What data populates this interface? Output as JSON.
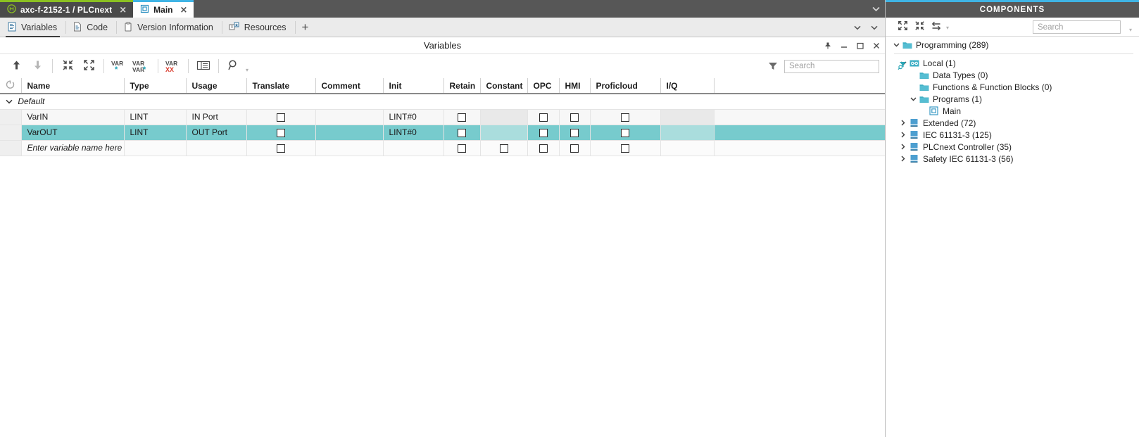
{
  "window": {
    "tabs": [
      {
        "label": "axc-f-2152-1 / PLCnext",
        "icon": "plc-device-icon",
        "close": "×",
        "active": false
      },
      {
        "label": "Main",
        "icon": "program-icon",
        "close": "×",
        "active": true
      }
    ],
    "overflow_chevron": "⌄"
  },
  "subtabs": {
    "items": [
      {
        "label": "Variables",
        "icon": "variables-icon",
        "active": true
      },
      {
        "label": "Code",
        "icon": "code-icon",
        "active": false
      },
      {
        "label": "Version Information",
        "icon": "version-information-icon",
        "active": false
      },
      {
        "label": "Resources",
        "icon": "resources-icon",
        "active": false
      }
    ],
    "add_label": "+",
    "chevron": "⌄"
  },
  "panel": {
    "title": "Variables",
    "buttons": [
      {
        "name": "pin-button",
        "glyph": "pin-icon"
      },
      {
        "name": "minimize-button",
        "glyph": "minimize-icon"
      },
      {
        "name": "maximize-button",
        "glyph": "maximize-icon"
      },
      {
        "name": "close-button",
        "glyph": "close-icon"
      }
    ]
  },
  "toolbar": {
    "buttons": [
      {
        "name": "move-up-button",
        "icon": "arrow-up-icon",
        "enabled": true
      },
      {
        "name": "move-down-button",
        "icon": "arrow-down-icon",
        "enabled": false
      },
      {
        "name": "collapse-all-button",
        "icon": "collapse-icon",
        "enabled": true
      },
      {
        "name": "expand-all-button",
        "icon": "expand-icon",
        "enabled": true
      },
      {
        "name": "add-variable-button",
        "icon": "var-add-icon",
        "enabled": true
      },
      {
        "name": "duplicate-variable-button",
        "icon": "var-var-add-icon",
        "enabled": true
      },
      {
        "name": "delete-variable-button",
        "icon": "var-delete-icon",
        "enabled": true
      },
      {
        "name": "table-settings-button",
        "icon": "table-icon",
        "enabled": true
      },
      {
        "name": "find-button",
        "icon": "magnifier-icon",
        "enabled": true
      }
    ],
    "filter_icon": "filter-icon",
    "search_placeholder": "Search",
    "search_value": "",
    "search_icon": "search-filter-icon"
  },
  "table": {
    "columns": [
      {
        "key": "handle",
        "label": "",
        "icon": "column-chooser-icon"
      },
      {
        "key": "name",
        "label": "Name"
      },
      {
        "key": "type",
        "label": "Type"
      },
      {
        "key": "usage",
        "label": "Usage"
      },
      {
        "key": "translate",
        "label": "Translate"
      },
      {
        "key": "comment",
        "label": "Comment"
      },
      {
        "key": "init",
        "label": "Init"
      },
      {
        "key": "retain",
        "label": "Retain"
      },
      {
        "key": "constant",
        "label": "Constant"
      },
      {
        "key": "opc",
        "label": "OPC"
      },
      {
        "key": "hmi",
        "label": "HMI"
      },
      {
        "key": "proficloud",
        "label": "Proficloud"
      },
      {
        "key": "iq",
        "label": "I/Q"
      },
      {
        "key": "filler",
        "label": ""
      }
    ],
    "group": {
      "label": "Default",
      "expanded": true,
      "twisty": "⌄"
    },
    "rows": [
      {
        "name": "VarIN",
        "type": "LINT",
        "usage": "IN Port",
        "translate": false,
        "comment": "",
        "init": "LINT#0",
        "retain": false,
        "constant": null,
        "opc": false,
        "hmi": false,
        "proficloud": false,
        "iq": null,
        "selected": false,
        "is_new": false
      },
      {
        "name": "VarOUT",
        "type": "LINT",
        "usage": "OUT Port",
        "translate": false,
        "comment": "",
        "init": "LINT#0",
        "retain": false,
        "constant": null,
        "opc": false,
        "hmi": false,
        "proficloud": false,
        "iq": null,
        "selected": true,
        "is_new": false
      },
      {
        "name": "Enter variable name here",
        "type": "",
        "usage": "",
        "translate": false,
        "comment": "",
        "init": "",
        "retain": false,
        "constant": false,
        "opc": false,
        "hmi": false,
        "proficloud": false,
        "iq": null,
        "selected": false,
        "is_new": true
      }
    ]
  },
  "components": {
    "header": "COMPONENTS",
    "toolbar": {
      "buttons": [
        {
          "name": "expand-all-button",
          "icon": "expand-icon"
        },
        {
          "name": "collapse-all-button",
          "icon": "collapse-icon"
        },
        {
          "name": "sync-button",
          "icon": "swap-arrows-icon"
        }
      ],
      "caret": "▾",
      "search_placeholder": "Search",
      "search_value": "",
      "search_icon": "search-filter-icon"
    },
    "tree": [
      {
        "label": "Programming (289)",
        "indent": 0,
        "twisty": "expanded",
        "icon": "folder-teal-icon"
      },
      {
        "label": "Local (1)",
        "indent": 1,
        "twisty": "expanded",
        "icon": "local-library-icon"
      },
      {
        "label": "Data Types (0)",
        "indent": 2,
        "twisty": "none",
        "icon": "folder-teal-icon"
      },
      {
        "label": "Functions & Function Blocks (0)",
        "indent": 2,
        "twisty": "none",
        "icon": "folder-teal-icon"
      },
      {
        "label": "Programs (1)",
        "indent": 2,
        "twisty": "expanded",
        "icon": "folder-teal-icon"
      },
      {
        "label": "Main",
        "indent": 3,
        "twisty": "none",
        "icon": "program-icon"
      },
      {
        "label": "Extended (72)",
        "indent": 1,
        "twisty": "collapsed",
        "icon": "library-blue-icon"
      },
      {
        "label": "IEC 61131-3 (125)",
        "indent": 1,
        "twisty": "collapsed",
        "icon": "library-blue-icon"
      },
      {
        "label": "PLCnext Controller (35)",
        "indent": 1,
        "twisty": "collapsed",
        "icon": "library-blue-icon"
      },
      {
        "label": "Safety IEC 61131-3 (56)",
        "indent": 1,
        "twisty": "collapsed",
        "icon": "library-blue-icon"
      }
    ]
  },
  "colors": {
    "accent_blue": "#3fb4e5",
    "accent_green": "#8bc021",
    "selection_teal": "#77cbcd",
    "selection_teal_light": "#aadddd",
    "header_gray": "#575757",
    "icon_teal": "#2aa5b5",
    "icon_blue": "#4a90c2",
    "icon_red": "#d93a2b"
  }
}
